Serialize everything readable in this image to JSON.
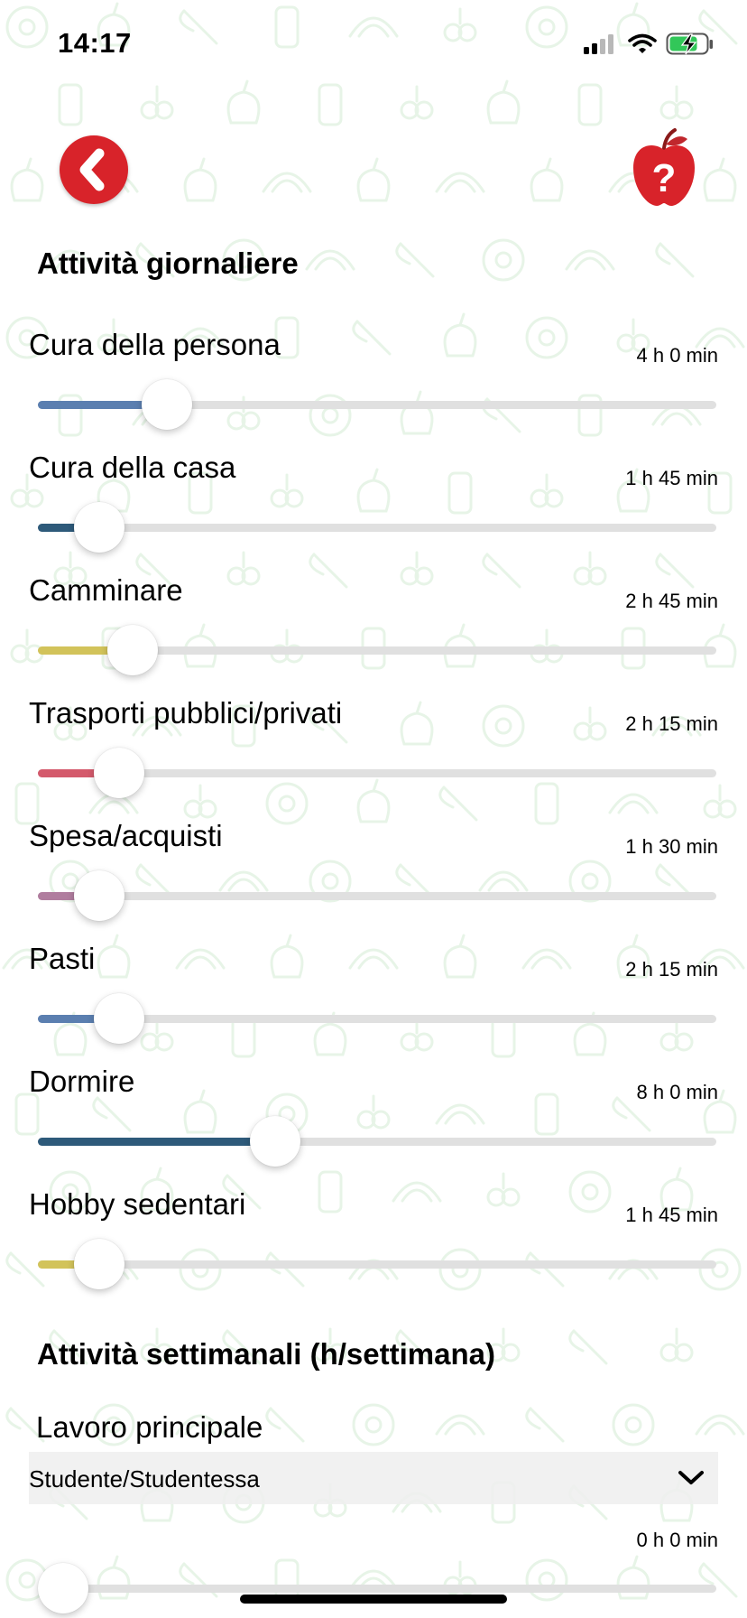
{
  "status_bar": {
    "time": "14:17",
    "battery": "charging"
  },
  "nav": {
    "back_icon": "chevron-left-icon",
    "help_icon": "apple-question-icon"
  },
  "daily": {
    "title": "Attività giornaliere",
    "activities": [
      {
        "label": "Cura della persona",
        "value": "4 h 0 min",
        "fraction": 0.19,
        "color": "#5b7fb0"
      },
      {
        "label": "Cura della casa",
        "value": "1 h 45 min",
        "fraction": 0.09,
        "color": "#2e5a7a"
      },
      {
        "label": "Camminare",
        "value": "2 h 45 min",
        "fraction": 0.14,
        "color": "#d2c35a"
      },
      {
        "label": "Trasporti pubblici/privati",
        "value": "2 h 15 min",
        "fraction": 0.12,
        "color": "#d45a6c"
      },
      {
        "label": "Spesa/acquisti",
        "value": "1 h 30 min",
        "fraction": 0.09,
        "color": "#b07d9e"
      },
      {
        "label": "Pasti",
        "value": "2 h 15 min",
        "fraction": 0.12,
        "color": "#5b7fb0"
      },
      {
        "label": "Dormire",
        "value": "8 h 0 min",
        "fraction": 0.35,
        "color": "#2e5a7a"
      },
      {
        "label": "Hobby sedentari",
        "value": "1 h 45 min",
        "fraction": 0.09,
        "color": "#d2c35a"
      }
    ]
  },
  "weekly": {
    "title": "Attività settimanali (h/settimana)",
    "main_work": {
      "label": "Lavoro principale",
      "selected": "Studente/Studentessa",
      "value": "0 h 0 min",
      "fraction": 0.0
    }
  },
  "colors": {
    "accent_red": "#d8232a",
    "track": "#e0e0e0",
    "pattern": "#4caf50"
  }
}
